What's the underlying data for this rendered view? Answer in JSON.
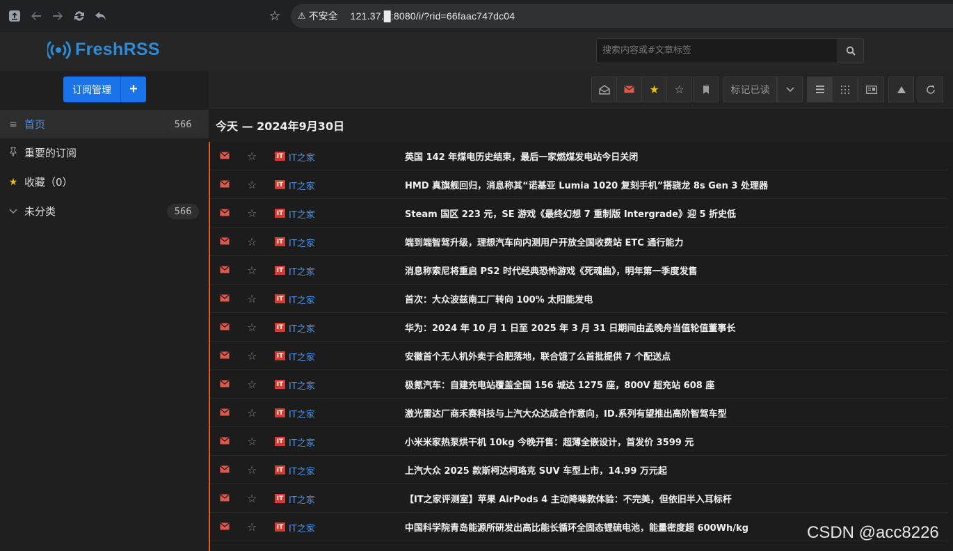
{
  "browser": {
    "insecure_label": "不安全",
    "url": "121.37.█:8080/i/?rid=66faac747dc04"
  },
  "app": {
    "logo": "FreshRSS",
    "search_placeholder": "搜索内容或#文章标签"
  },
  "sidebar": {
    "subscribe_label": "订阅管理",
    "add_label": "+",
    "items": [
      {
        "label": "首页",
        "count": "566",
        "icon": "list-icon"
      },
      {
        "label": "重要的订阅",
        "count": "",
        "icon": "pin-icon"
      },
      {
        "label": "收藏（0）",
        "count": "",
        "icon": "star-icon"
      },
      {
        "label": "未分类",
        "count": "566",
        "icon": "chevron-down-icon"
      }
    ]
  },
  "toolbar": {
    "mark_read_label": "标记已读"
  },
  "date_header": "今天 — 2024年9月30日",
  "feed_label": "IT之家",
  "feed_icon_text": "IT",
  "articles": [
    "英国 142 年煤电历史结束，最后一家燃煤发电站今日关闭",
    "HMD 真旗舰回归，消息称其“诺基亚 Lumia 1020 复刻手机”搭骁龙 8s Gen 3 处理器",
    "Steam 国区 223 元，SE 游戏《最终幻想 7 重制版 Intergrade》迎 5 折史低",
    "端到端智驾升级，理想汽车向内测用户开放全国收费站 ETC 通行能力",
    "消息称索尼将重启 PS2 时代经典恐怖游戏《死魂曲》，明年第一季度发售",
    "首次：大众波兹南工厂转向 100% 太阳能发电",
    "华为：2024 年 10 月 1 日至 2025 年 3 月 31 日期间由孟晚舟当值轮值董事长",
    "安徽首个无人机外卖于合肥落地，联合饿了么首批提供 7 个配送点",
    "极氪汽车：自建充电站覆盖全国 156 城达 1275 座，800V 超充站 608 座",
    "激光雷达厂商禾赛科技与上汽大众达成合作意向，ID.系列有望推出高阶智驾车型",
    "小米米家热泵烘干机 10kg 今晚开售：超薄全嵌设计，首发价 3599 元",
    "上汽大众 2025 款斯柯达柯珞克 SUV 车型上市，14.99 万元起",
    "【IT之家评测室】苹果 AirPods 4 主动降噪款体验：不完美，但依旧半入耳标杆",
    "中国科学院青岛能源所研发出高比能长循环全固态锂硫电池，能量密度超 600Wh/kg"
  ],
  "watermark": "CSDN @acc8226"
}
